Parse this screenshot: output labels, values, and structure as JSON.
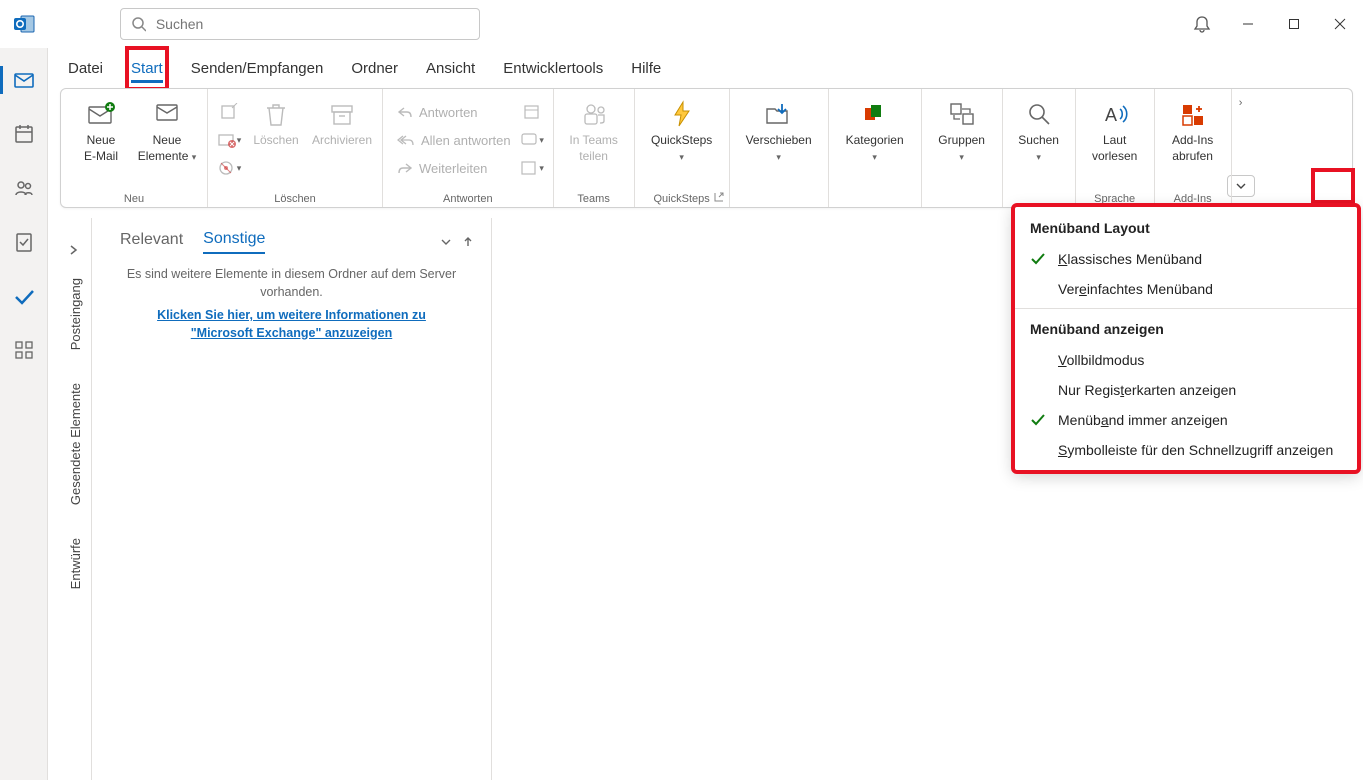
{
  "search": {
    "placeholder": "Suchen"
  },
  "tabs": [
    "Datei",
    "Start",
    "Senden/Empfangen",
    "Ordner",
    "Ansicht",
    "Entwicklertools",
    "Hilfe"
  ],
  "ribbon": {
    "groups": {
      "neu": {
        "label": "Neu",
        "new_email": "Neue\nE-Mail",
        "new_items": "Neue\nElemente"
      },
      "loeschen": {
        "label": "Löschen",
        "delete": "Löschen",
        "archive": "Archivieren"
      },
      "antworten": {
        "label": "Antworten",
        "reply": "Antworten",
        "reply_all": "Allen antworten",
        "forward": "Weiterleiten"
      },
      "teams": {
        "label": "Teams",
        "share": "In Teams\nteilen"
      },
      "quicksteps": {
        "label": "QuickSteps",
        "btn": "QuickSteps"
      },
      "verschieben": {
        "label": "Verschieben",
        "btn": "Verschieben"
      },
      "kategorien": {
        "label": "Kategorien",
        "btn": "Kategorien"
      },
      "gruppen": {
        "label": "Gruppen",
        "btn": "Gruppen"
      },
      "suchen": {
        "label": "Suchen",
        "btn": "Suchen"
      },
      "sprache": {
        "label": "Sprache",
        "btn": "Laut\nvorlesen"
      },
      "addins": {
        "label": "Add-Ins",
        "btn": "Add-Ins\nabrufen"
      }
    }
  },
  "folders": {
    "inbox": "Posteingang",
    "sent": "Gesendete Elemente",
    "drafts": "Entwürfe"
  },
  "message_list": {
    "tab_relevant": "Relevant",
    "tab_other": "Sonstige",
    "info": "Es sind weitere Elemente in diesem Ordner auf dem Server vorhanden.",
    "link": "Klicken Sie hier, um weitere Informationen zu \"Microsoft Exchange\" anzuzeigen"
  },
  "ribbon_menu": {
    "header1": "Menüband Layout",
    "item_classic": "lassisches Menüband",
    "item_classic_u": "K",
    "item_simple": "einfachtes Menüband",
    "item_simple_u": "Ver",
    "header2": "Menüband anzeigen",
    "item_full": "ollbildmodus",
    "item_full_u": "V",
    "item_tabsonly": "erkarten anzeigen",
    "item_tabsonly_pre": "Nur Regis",
    "item_tabsonly_u": "t",
    "item_always": "nd immer anzeigen",
    "item_always_pre": "Menüb",
    "item_always_u": "a",
    "item_qatoolbar": "ymbolleiste für den Schnellzugriff anzeigen",
    "item_qatoolbar_u": "S"
  }
}
